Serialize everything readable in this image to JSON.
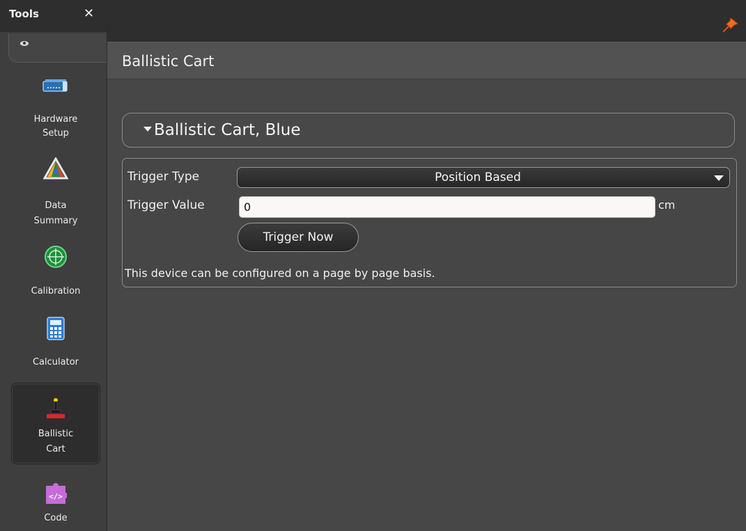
{
  "sidebar": {
    "title": "Tools",
    "close_glyph": "✕",
    "tools": [
      {
        "label_line1": "Hardware",
        "label_line2": "Setup",
        "icon": "hardware-setup-icon"
      },
      {
        "label_line1": "Data",
        "label_line2": "Summary",
        "icon": "data-summary-icon"
      },
      {
        "label_line1": "Calibration",
        "label_line2": "",
        "icon": "calibration-icon"
      },
      {
        "label_line1": "Calculator",
        "label_line2": "",
        "icon": "calculator-icon"
      },
      {
        "label_line1": "Ballistic",
        "label_line2": "Cart",
        "icon": "ballistic-cart-icon",
        "selected": true
      },
      {
        "label_line1": "Code",
        "label_line2": "",
        "icon": "code-icon"
      }
    ]
  },
  "page": {
    "title": "Ballistic Cart",
    "pin_icon": "pin-icon"
  },
  "device": {
    "section_title": "Ballistic Cart, Blue",
    "expanded": true,
    "trigger_type_label": "Trigger Type",
    "trigger_type_value": "Position Based",
    "trigger_value_label": "Trigger Value",
    "trigger_value": "0",
    "trigger_value_unit": "cm",
    "trigger_now_label": "Trigger Now",
    "note": "This device can be configured on a page by page basis."
  },
  "colors": {
    "background": "#474747",
    "sidebar": "#3e3e3e",
    "header": "#2e2e2e",
    "accent_pin": "#f26b1f"
  }
}
